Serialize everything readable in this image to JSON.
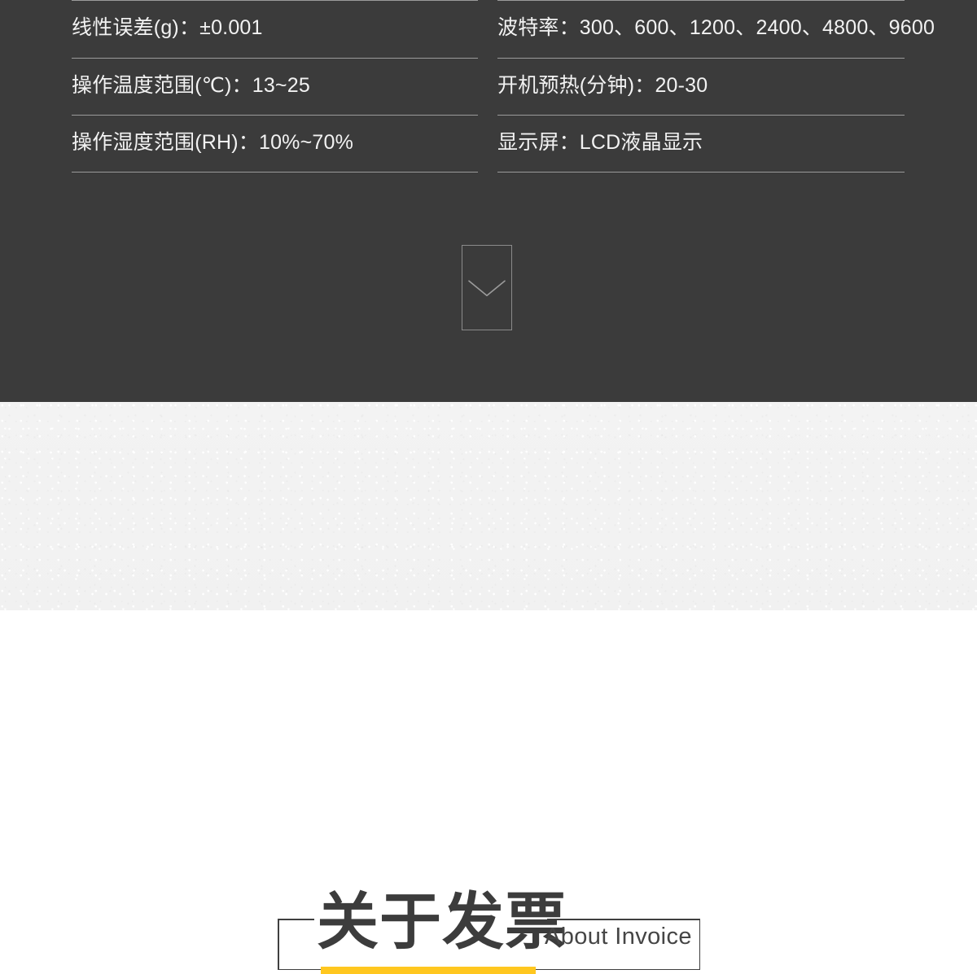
{
  "theme": {
    "dark_bg": "#3b3b3b",
    "light_bg": "#f2f2f2",
    "divider": "#9a9a9a",
    "spec_text": "#f2f2f2",
    "accent_yellow": "#FFC71F",
    "frame_stroke": "#3f3f3f",
    "chevron_stroke": "#8b8b8b"
  },
  "specs": {
    "left_column": [
      {
        "label": "线性误差(g)：",
        "value": "±0.001",
        "full": "线性误差(g)：±0.001"
      },
      {
        "label": "操作温度范围(℃)：",
        "value": "13~25",
        "full": "操作温度范围(℃)：13~25"
      },
      {
        "label": "操作湿度范围(RH)：",
        "value": "10%~70%",
        "full": "操作湿度范围(RH)：10%~70%"
      }
    ],
    "right_column": [
      {
        "label": "波特率：",
        "value": "300、600、1200、2400、4800、9600",
        "full": "波特率：300、600、1200、2400、4800、9600"
      },
      {
        "label": "开机预热(分钟)：",
        "value": "20-30",
        "full": "开机预热(分钟)：20-30"
      },
      {
        "label": "显示屏：",
        "value": "LCD液晶显示",
        "full": "显示屏：LCD液晶显示"
      }
    ]
  },
  "expand_control": {
    "icon": "chevron-down-icon"
  },
  "section_heading": {
    "title_cn": "关于发票",
    "title_en": "About Invoice"
  }
}
